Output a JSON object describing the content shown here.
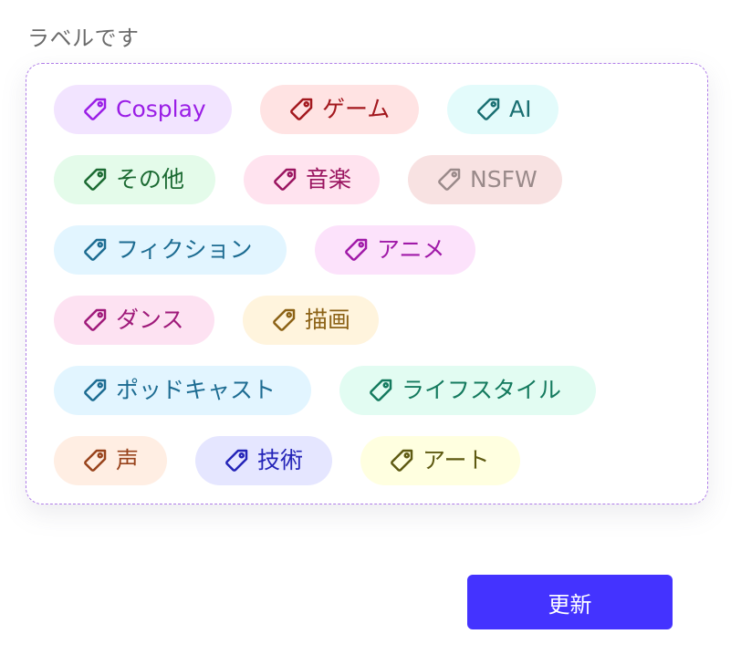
{
  "section": {
    "title": "ラベルです"
  },
  "tags": [
    {
      "label": "Cosplay",
      "color": "#9a1ee6",
      "background": "#f2e4ff"
    },
    {
      "label": "ゲーム",
      "color": "#a3181e",
      "background": "#ffe3e3"
    },
    {
      "label": "AI",
      "color": "#1a6f72",
      "background": "#e3fbfb"
    },
    {
      "label": "その他",
      "color": "#1b6a32",
      "background": "#e4fbea"
    },
    {
      "label": "音楽",
      "color": "#9a1560",
      "background": "#ffe3ef"
    },
    {
      "label": "NSFW",
      "color": "#9a8a8a",
      "background": "#f8e2e2"
    },
    {
      "label": "フィクション",
      "color": "#1d6c92",
      "background": "#e2f5ff"
    },
    {
      "label": "アニメ",
      "color": "#a01aa8",
      "background": "#fce2fb"
    },
    {
      "label": "ダンス",
      "color": "#9f1a7a",
      "background": "#fde2f2"
    },
    {
      "label": "描画",
      "color": "#8c6216",
      "background": "#fff4dd"
    },
    {
      "label": "ポッドキャスト",
      "color": "#1d6c92",
      "background": "#e2f5ff"
    },
    {
      "label": "ライフスタイル",
      "color": "#147a5e",
      "background": "#e2fcf2"
    },
    {
      "label": "声",
      "color": "#98431c",
      "background": "#ffeee3"
    },
    {
      "label": "技術",
      "color": "#2424b8",
      "background": "#e5e6ff"
    },
    {
      "label": "アート",
      "color": "#5e5a12",
      "background": "#ffffe0"
    }
  ],
  "actions": {
    "update_label": "更新",
    "update_color": "#4433ff"
  }
}
